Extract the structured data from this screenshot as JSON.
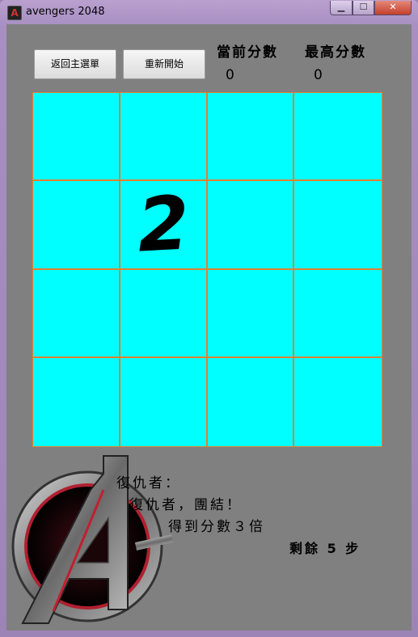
{
  "window": {
    "title": "avengers 2048",
    "min_label": "▁",
    "max_label": "☐",
    "close_label": "✕"
  },
  "toolbar": {
    "back_label": "返回主選單",
    "restart_label": "重新開始"
  },
  "score": {
    "current_label": "當前分數",
    "current_value": "0",
    "best_label": "最高分數",
    "best_value": "0"
  },
  "board": {
    "rows": 4,
    "cols": 4,
    "tiles": [
      [
        "",
        "",
        "",
        ""
      ],
      [
        "",
        "2",
        "",
        ""
      ],
      [
        "",
        "",
        "",
        ""
      ],
      [
        "",
        "",
        "",
        ""
      ]
    ]
  },
  "message": {
    "line1": "復仇者：",
    "line2": "復仇者，團結！",
    "line3": "得到分數３倍",
    "steps": "剩餘 5 步"
  },
  "colors": {
    "board": "#00ffff",
    "grid": "#e08030",
    "client": "#808080"
  },
  "logo": {
    "icon": "avengers-logo"
  }
}
